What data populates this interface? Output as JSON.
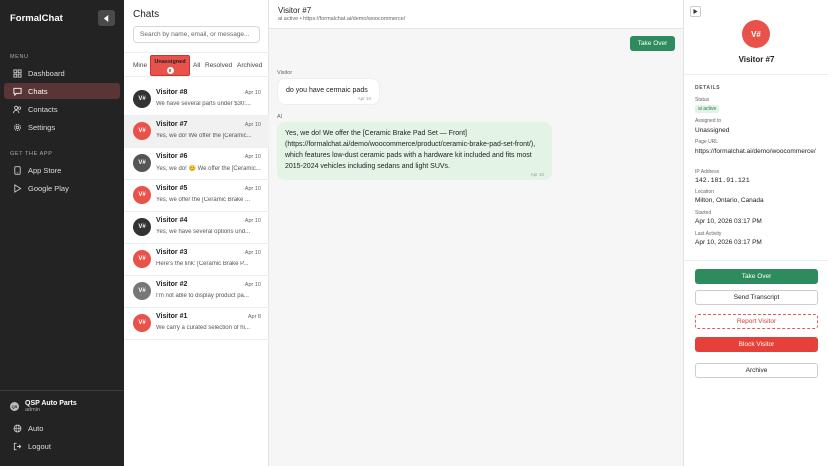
{
  "app": {
    "brand": "FormalChat",
    "menu_label": "MENU",
    "nav": [
      {
        "label": "Dashboard",
        "icon": "grid-icon"
      },
      {
        "label": "Chats",
        "icon": "chat-icon"
      },
      {
        "label": "Contacts",
        "icon": "people-icon"
      },
      {
        "label": "Settings",
        "icon": "gear-icon"
      }
    ],
    "get_app_label": "GET THE APP",
    "app_links": [
      {
        "label": "App Store",
        "icon": "apple-icon"
      },
      {
        "label": "Google Play",
        "icon": "play-store-icon"
      }
    ],
    "workspace": {
      "initials": "QS",
      "name": "QSP Auto Parts",
      "role": "admin"
    },
    "bottom": [
      {
        "label": "Auto",
        "icon": "globe-icon"
      },
      {
        "label": "Logout",
        "icon": "logout-icon"
      }
    ]
  },
  "chats": {
    "title": "Chats",
    "search_placeholder": "Search by name, email, or message...",
    "filters": {
      "mine": "Mine",
      "unassigned": "Unassigned",
      "unassigned_count": "8",
      "all": "All",
      "resolved": "Resolved",
      "archived": "Archived"
    },
    "items": [
      {
        "name": "Visitor #8",
        "date": "Apr 10",
        "preview": "We have several parts under $30:...",
        "initials": "V#",
        "color": "#333333"
      },
      {
        "name": "Visitor #7",
        "date": "Apr 10",
        "preview": "Yes, we do! We offer the [Ceramic...",
        "initials": "V#",
        "color": "#e8524a"
      },
      {
        "name": "Visitor #6",
        "date": "Apr 10",
        "preview": "Yes, we do! 😊 We offer the [Ceramic...",
        "initials": "V#",
        "color": "#555555"
      },
      {
        "name": "Visitor #5",
        "date": "Apr 10",
        "preview": "Yes, we offer the [Ceramic Brake ...",
        "initials": "V#",
        "color": "#e8524a"
      },
      {
        "name": "Visitor #4",
        "date": "Apr 10",
        "preview": "Yes, we have several options und...",
        "initials": "V#",
        "color": "#333333"
      },
      {
        "name": "Visitor #3",
        "date": "Apr 10",
        "preview": "Here's the link: [Ceramic Brake P...",
        "initials": "V#",
        "color": "#e8524a"
      },
      {
        "name": "Visitor #2",
        "date": "Apr 10",
        "preview": "I'm not able to display product pa...",
        "initials": "V#",
        "color": "#777777"
      },
      {
        "name": "Visitor #1",
        "date": "Apr 8",
        "preview": "We carry a curated selection of hi...",
        "initials": "V#",
        "color": "#e8524a"
      }
    ]
  },
  "conversation": {
    "title": "Visitor #7",
    "subtitle": "ai active • https://formalchat.ai/demo/woocommerce/",
    "take_over": "Take Over",
    "visitor_label": "Visitor",
    "visitor_msg": "do you have cermaic pads",
    "visitor_time": "Apr 10",
    "ai_label": "AI",
    "ai_msg": "Yes, we do! We offer the [Ceramic Brake Pad Set — Front](https://formalchat.ai/demo/woocommerce/product/ceramic-brake-pad-set-front/), which features low-dust ceramic pads with a hardware kit included and fits most 2015-2024 vehicles including sedans and light SUVs.",
    "ai_time": "Apr 10"
  },
  "details": {
    "initials": "V#",
    "name": "Visitor #7",
    "section": "DETAILS",
    "status_label": "Status",
    "status": "ai active",
    "assigned_label": "Assigned to",
    "assigned": "Unassigned",
    "page_label": "Page URL",
    "page": "https://formalchat.ai/demo/woocommerce/",
    "ip_label": "IP Address",
    "ip": "142.181.91.121",
    "location_label": "Location",
    "location": "Milton, Ontario, Canada",
    "started_label": "Started",
    "started": "Apr 10, 2026 03:17 PM",
    "last_label": "Last Activity",
    "last": "Apr 10, 2026 03:17 PM",
    "btn_takeover": "Take Over",
    "btn_transcript": "Send Transcript",
    "btn_report": "Report Visitor",
    "btn_block": "Block Visitor",
    "btn_archive": "Archive"
  }
}
